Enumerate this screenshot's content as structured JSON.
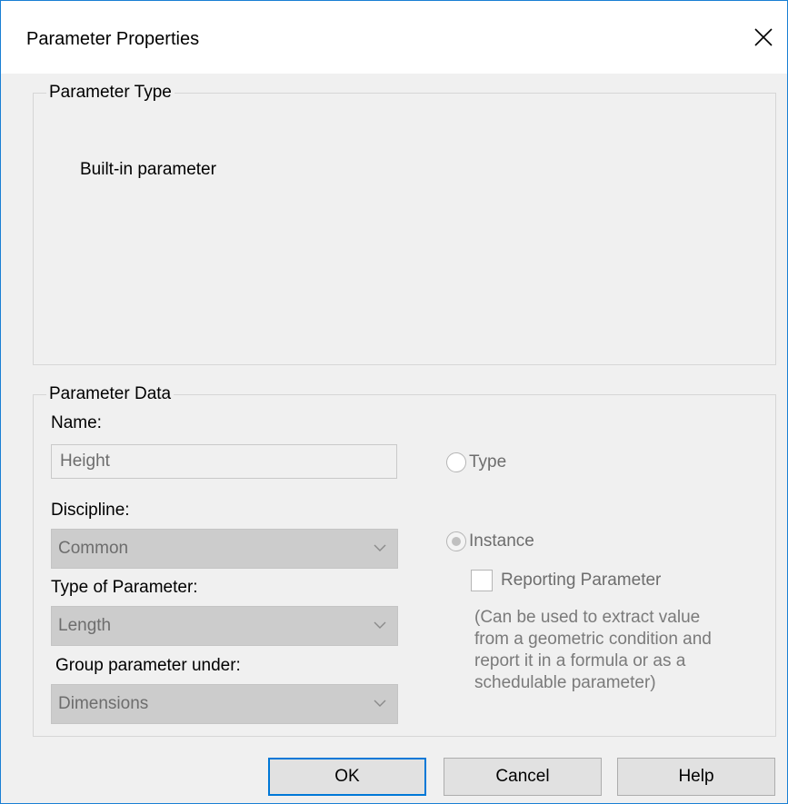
{
  "window": {
    "title": "Parameter Properties",
    "close_icon": "close-icon"
  },
  "parameter_type": {
    "legend": "Parameter Type",
    "value": "Built-in parameter"
  },
  "parameter_data": {
    "legend": "Parameter Data",
    "name_label": "Name:",
    "name_value": "Height",
    "discipline_label": "Discipline:",
    "discipline_value": "Common",
    "type_of_parameter_label": "Type of Parameter:",
    "type_of_parameter_value": "Length",
    "group_label": "Group parameter under:",
    "group_value": "Dimensions",
    "radio_type_label": "Type",
    "radio_type_checked": false,
    "radio_instance_label": "Instance",
    "radio_instance_checked": true,
    "reporting_label": "Reporting Parameter",
    "reporting_checked": false,
    "reporting_note_lines": [
      "(Can be used to extract value",
      "from a geometric condition and",
      "report it in a formula or as a",
      "schedulable parameter)"
    ]
  },
  "buttons": {
    "ok": "OK",
    "cancel": "Cancel",
    "help": "Help"
  },
  "colors": {
    "window_border": "#1a7fd4",
    "default_button_border": "#0078d7",
    "dialog_background": "#f0f0f0",
    "disabled_combo": "#cccccc"
  }
}
